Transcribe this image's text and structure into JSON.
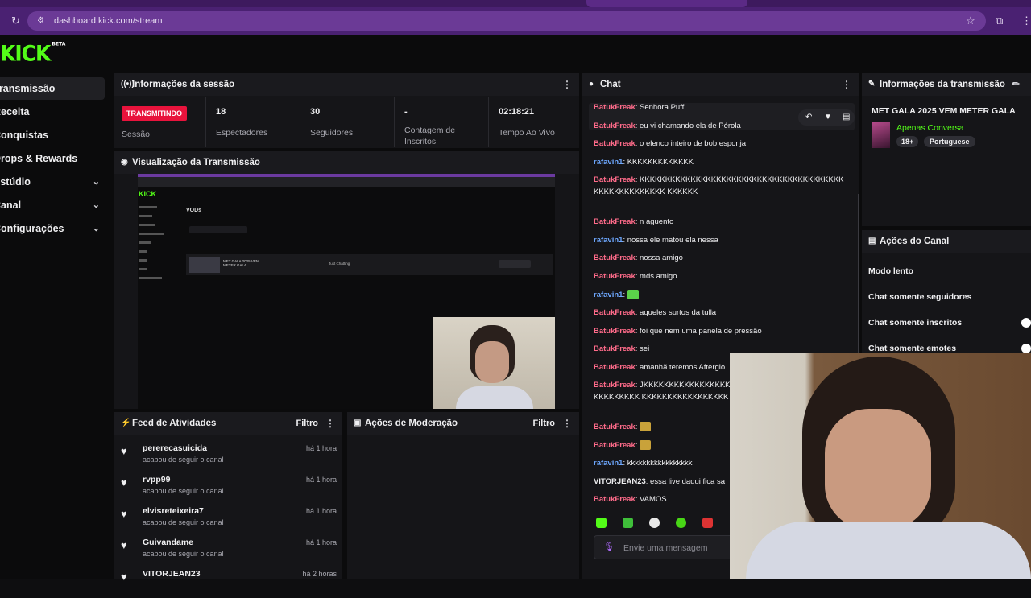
{
  "browser": {
    "url": "dashboard.kick.com/stream"
  },
  "brand": {
    "logo": "KICK",
    "beta": "BETA",
    "accent": "#53fc18"
  },
  "nav": [
    {
      "label": "Transmissão",
      "active": true
    },
    {
      "label": "Receita"
    },
    {
      "label": "Conquistas"
    },
    {
      "label": "Drops & Rewards"
    },
    {
      "label": "Estúdio",
      "chevron": "⌄"
    },
    {
      "label": "Canal",
      "chevron": "⌄"
    },
    {
      "label": "Configurações",
      "chevron": "⌄"
    }
  ],
  "session": {
    "title": "Informações da sessão",
    "live_badge": "TRANSMITINDO",
    "session_label": "Sessão",
    "stats": [
      {
        "value": "18",
        "label": "Espectadores"
      },
      {
        "value": "30",
        "label": "Seguidores"
      },
      {
        "value": "-",
        "label": "Contagem de Inscritos"
      },
      {
        "value": "02:18:21",
        "label": "Tempo Ao Vivo"
      }
    ]
  },
  "preview": {
    "title": "Visualização da Transmissão",
    "inner_page_title": "VODs",
    "inner_row_title": "MET GALA 2025 VEM METER GALA",
    "inner_category": "Just Chatting"
  },
  "feed": {
    "title": "Feed de Atividades",
    "filter": "Filtro",
    "items": [
      {
        "name": "pererecasuicida",
        "sub": "acabou de seguir o canal",
        "time": "há 1 hora"
      },
      {
        "name": "rvpp99",
        "sub": "acabou de seguir o canal",
        "time": "há 1 hora"
      },
      {
        "name": "elvisreteixeira7",
        "sub": "acabou de seguir o canal",
        "time": "há 1 hora"
      },
      {
        "name": "Guivandame",
        "sub": "acabou de seguir o canal",
        "time": "há 1 hora"
      },
      {
        "name": "VITORJEAN23",
        "sub": "",
        "time": "há 2 horas"
      }
    ]
  },
  "moderation": {
    "title": "Ações de Moderação",
    "filter": "Filtro"
  },
  "chat": {
    "title": "Chat",
    "input_placeholder": "Envie uma mensagem",
    "messages": [
      {
        "user": "BatukFreak",
        "color": "#ff6b8a",
        "text": "Senhora Puff"
      },
      {
        "user": "BatukFreak",
        "color": "#ff6b8a",
        "text": "eu vi chamando ela de Pérola"
      },
      {
        "user": "BatukFreak",
        "color": "#ff6b8a",
        "text": "o elenco inteiro de bob esponja"
      },
      {
        "user": "rafavin1",
        "color": "#6ea8ff",
        "text": "KKKKKKKKKKKKK"
      },
      {
        "user": "BatukFreak",
        "color": "#ff6b8a",
        "text": "KKKKKKKKKKKKKKKKKKKKKKKKKKKKKKKKKKKKKKKKKKKKKKKKKKKKKK KKKKKK"
      },
      {
        "user": "BatukFreak",
        "color": "#ff6b8a",
        "text": "n aguento"
      },
      {
        "user": "rafavin1",
        "color": "#6ea8ff",
        "text": "nossa ele matou ela nessa"
      },
      {
        "user": "BatukFreak",
        "color": "#ff6b8a",
        "text": "nossa amigo"
      },
      {
        "user": "BatukFreak",
        "color": "#ff6b8a",
        "text": "mds amigo"
      },
      {
        "user": "rafavin1",
        "color": "#6ea8ff",
        "text": ""
      },
      {
        "user": "BatukFreak",
        "color": "#ff6b8a",
        "text": "aqueles surtos da tulla"
      },
      {
        "user": "BatukFreak",
        "color": "#ff6b8a",
        "text": "foi que nem uma panela de pressão"
      },
      {
        "user": "BatukFreak",
        "color": "#ff6b8a",
        "text": "sei"
      },
      {
        "user": "BatukFreak",
        "color": "#ff6b8a",
        "text": "amanhã teremos Afterglo"
      },
      {
        "user": "BatukFreak",
        "color": "#ff6b8a",
        "text": "JKKKKKKKKKKKKKKKKKKKKKKKKKK KKKKKKKKKKKKKKKKK"
      },
      {
        "user": "BatukFreak",
        "color": "#ff6b8a",
        "text": ""
      },
      {
        "user": "BatukFreak",
        "color": "#ff6b8a",
        "text": ""
      },
      {
        "user": "rafavin1",
        "color": "#6ea8ff",
        "text": "kkkkkkkkkkkkkkkkk"
      },
      {
        "user": "VITORJEAN23",
        "color": "#efeff1",
        "text": "essa live daqui fica sa"
      },
      {
        "user": "BatukFreak",
        "color": "#ff6b8a",
        "text": "VAMOS"
      }
    ]
  },
  "stream_info": {
    "title": "Informações da transmissão",
    "stream_title": "MET GALA 2025 VEM METER GALA",
    "category": "Apenas Conversa",
    "tags": [
      "18+",
      "Portuguese"
    ]
  },
  "channel_actions": {
    "title": "Ações do Canal",
    "items": [
      "Modo lento",
      "Chat somente seguidores",
      "Chat somente inscritos",
      "Chat somente emotes"
    ]
  }
}
